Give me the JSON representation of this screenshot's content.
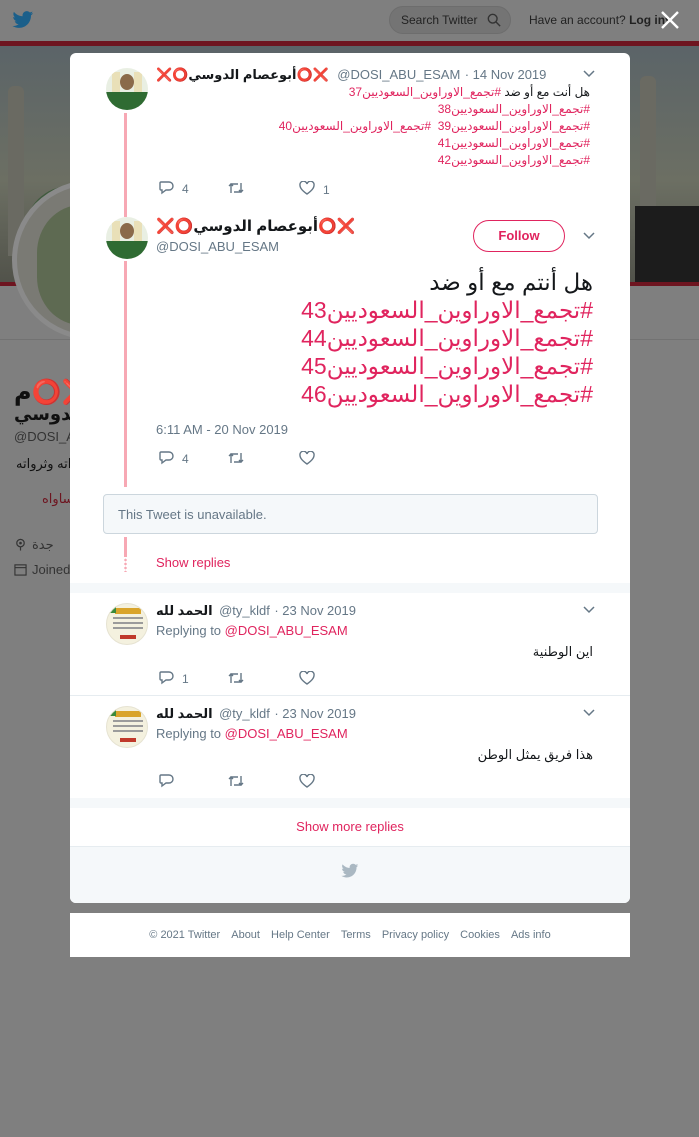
{
  "background": {
    "search_placeholder": "Search Twitter",
    "account_prompt": "Have an account?",
    "login_label": "Log in",
    "profile_name_line1": "❌⭕م",
    "profile_name_line2": "الدوسي",
    "profile_handle": "@DOSI_A",
    "profile_bio": "اته وثرواته",
    "profile_bio2": "ساواه",
    "profile_location": "جدة",
    "profile_joined": "Joined"
  },
  "thread": {
    "tweet1": {
      "name": "❌⭕أبوعصام الدوسي⭕❌",
      "handle": "@DOSI_ABU_ESAM",
      "date": "· 14 Nov 2019",
      "line1_plain": "هل أنت مع أو ضد ",
      "line1_hash": "#تجمع_الاوراوين_السعوديين37",
      "line2_hash": "#تجمع_الاوراوين_السعوديين38",
      "line3_hash_a": "#تجمع_الاوراوين_السعوديين39",
      "line3_hash_b": "#تجمع_الاوراوين_السعوديين40",
      "line4_hash": "#تجمع_الاوراوين_السعوديين41",
      "line5_hash": "#تجمع_الاوراوين_السعوديين42",
      "replies": "4",
      "retweets": "",
      "likes": "1"
    },
    "main": {
      "name": "❌⭕أبوعصام الدوسي⭕❌",
      "handle": "@DOSI_ABU_ESAM",
      "follow_label": "Follow",
      "line1": "هل أنتم مع أو ضد",
      "hash1": "#تجمع_الاوراوين_السعوديين43",
      "hash2": "#تجمع_الاوراوين_السعوديين44",
      "hash3": "#تجمع_الاوراوين_السعوديين45",
      "hash4": "#تجمع_الاوراوين_السعوديين46",
      "timestamp": "6:11 AM - 20 Nov 2019",
      "replies": "4"
    },
    "unavailable_text": "This Tweet is unavailable.",
    "show_replies": "Show replies"
  },
  "replies": [
    {
      "name": "الحمد لله",
      "handle": "@ty_kldf",
      "date": "· 23 Nov 2019",
      "replying_label": "Replying to",
      "replying_to": "@DOSI_ABU_ESAM",
      "text": "اين الوطنية",
      "replies": "1"
    },
    {
      "name": "الحمد لله",
      "handle": "@ty_kldf",
      "date": "· 23 Nov 2019",
      "replying_label": "Replying to",
      "replying_to": "@DOSI_ABU_ESAM",
      "text": "هذا فريق يمثل الوطن",
      "replies": ""
    }
  ],
  "show_more_replies": "Show more replies",
  "footer": {
    "copyright": "© 2021 Twitter",
    "about": "About",
    "help": "Help Center",
    "terms": "Terms",
    "privacy": "Privacy policy",
    "cookies": "Cookies",
    "ads": "Ads info"
  },
  "colors": {
    "accent": "#e0245e",
    "thread_line": "#f7a8b4",
    "muted": "#657786"
  },
  "icons": [
    "twitter-bird-icon",
    "search-icon",
    "close-icon",
    "chevron-down-icon",
    "reply-icon",
    "retweet-icon",
    "like-icon",
    "location-icon",
    "calendar-icon"
  ]
}
